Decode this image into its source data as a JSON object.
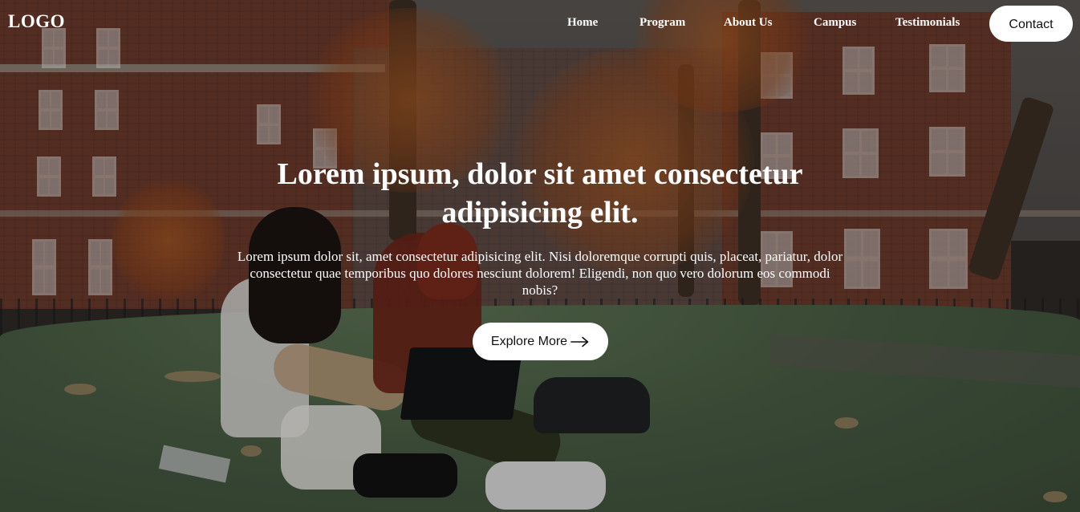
{
  "header": {
    "logo": "LOGO",
    "nav": [
      {
        "label": "Home"
      },
      {
        "label": "Program"
      },
      {
        "label": "About Us"
      },
      {
        "label": "Campus"
      },
      {
        "label": "Testimonials"
      }
    ],
    "contact_label": "Contact"
  },
  "hero": {
    "title": "Lorem ipsum, dolor sit amet consectetur adipisicing elit.",
    "description": "Lorem ipsum dolor sit, amet consectetur adipisicing elit. Nisi doloremque corrupti quis, placeat, pariatur, dolor consectetur quae temporibus quo dolores nesciunt dolorem! Eligendi, non quo vero dolorum eos commodi nobis?",
    "cta_label": "Explore More",
    "cta_icon": "arrow-right-icon"
  },
  "colors": {
    "text": "#ffffff",
    "button_bg": "#ffffff",
    "button_text": "#111111",
    "overlay": "rgba(0,0,0,0.22)"
  }
}
